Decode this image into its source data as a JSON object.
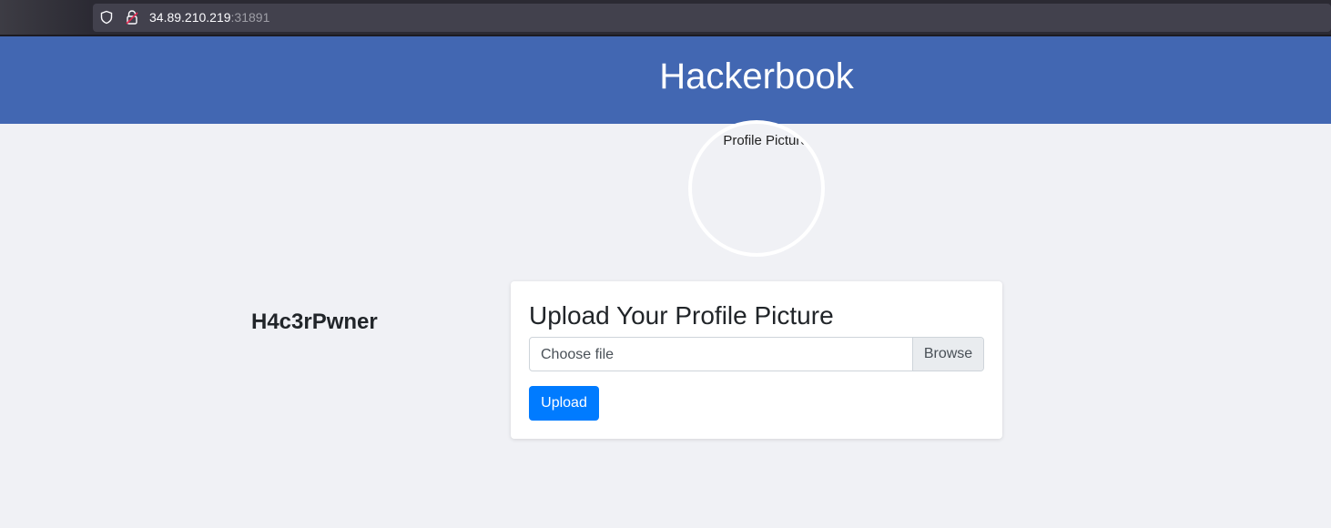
{
  "browser": {
    "url_host": "34.89.210.219",
    "url_port": ":31891",
    "icons": [
      "shield-icon",
      "lock-icon"
    ]
  },
  "header": {
    "title": "Hackerbook",
    "bg_color": "#4267b2"
  },
  "profile": {
    "picture_alt": "Profile Picture",
    "username": "H4c3rPwner"
  },
  "upload": {
    "title": "Upload Your Profile Picture",
    "file_placeholder": "Choose file",
    "browse_label": "Browse",
    "upload_label": "Upload",
    "button_color": "#007bff"
  }
}
